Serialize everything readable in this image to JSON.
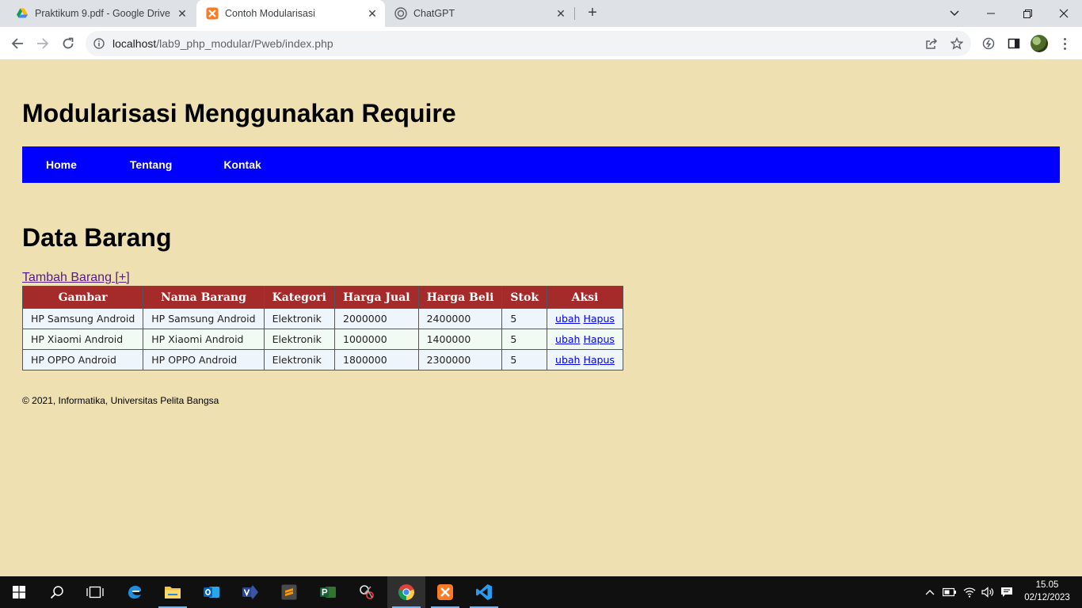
{
  "browser": {
    "tabs": [
      {
        "title": "Praktikum 9.pdf - Google Drive",
        "icon": "google-drive-icon",
        "active": false
      },
      {
        "title": "Contoh Modularisasi",
        "icon": "xampp-icon",
        "active": true
      },
      {
        "title": "ChatGPT",
        "icon": "chatgpt-icon",
        "active": false
      }
    ],
    "url_host": "localhost",
    "url_path": "/lab9_php_modular/Pweb/index.php"
  },
  "page": {
    "site_title": "Modularisasi Menggunakan Require",
    "nav": [
      "Home",
      "Tentang",
      "Kontak"
    ],
    "section_title": "Data Barang",
    "add_link": "Tambah Barang [+]",
    "table": {
      "headers": [
        "Gambar",
        "Nama Barang",
        "Kategori",
        "Harga Jual",
        "Harga Beli",
        "Stok",
        "Aksi"
      ],
      "rows": [
        {
          "gambar": "HP Samsung Android",
          "nama": "HP Samsung Android",
          "kategori": "Elektronik",
          "jual": "2000000",
          "beli": "2400000",
          "stok": "5"
        },
        {
          "gambar": "HP Xiaomi Android",
          "nama": "HP Xiaomi Android",
          "kategori": "Elektronik",
          "jual": "1000000",
          "beli": "1400000",
          "stok": "5"
        },
        {
          "gambar": "HP OPPO Android",
          "nama": "HP OPPO Android",
          "kategori": "Elektronik",
          "jual": "1800000",
          "beli": "2300000",
          "stok": "5"
        }
      ],
      "action_edit": "ubah",
      "action_delete": "Hapus"
    },
    "footer": "© 2021, Informatika, Universitas Pelita Bangsa"
  },
  "colors": {
    "page_bg": "#eee0b1",
    "nav_bg": "#0000ff",
    "table_header_bg": "#a52a2a"
  },
  "taskbar": {
    "icons": [
      "windows-start-icon",
      "search-icon",
      "task-view-icon",
      "edge-icon",
      "file-explorer-icon",
      "outlook-icon",
      "visio-icon",
      "sublime-text-icon",
      "project-icon",
      "snipping-tool-icon",
      "chrome-icon",
      "xampp-icon",
      "vscode-icon"
    ],
    "time": "15.05",
    "date": "02/12/2023"
  }
}
